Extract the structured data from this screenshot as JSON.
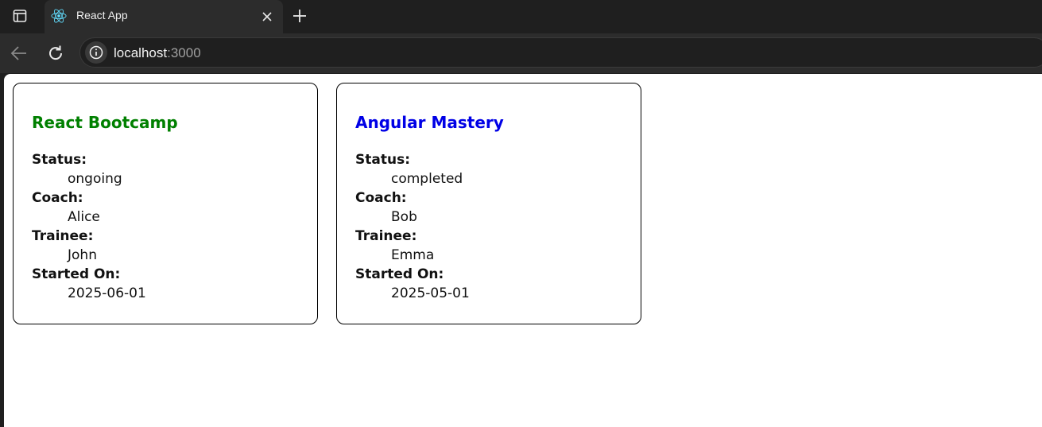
{
  "browser": {
    "tab_title": "React App",
    "url_host": "localhost",
    "url_port": ":3000"
  },
  "cards": [
    {
      "title": "React Bootcamp",
      "title_color": "#008000",
      "status_label": "Status:",
      "status": "ongoing",
      "coach_label": "Coach:",
      "coach": "Alice",
      "trainee_label": "Trainee:",
      "trainee": "John",
      "started_label": "Started On:",
      "started_on": "2025-06-01"
    },
    {
      "title": "Angular Mastery",
      "title_color": "#0000e6",
      "status_label": "Status:",
      "status": "completed",
      "coach_label": "Coach:",
      "coach": "Bob",
      "trainee_label": "Trainee:",
      "trainee": "Emma",
      "started_label": "Started On:",
      "started_on": "2025-05-01"
    }
  ],
  "icons": {
    "sidebar": "sidebar-toggle-icon",
    "favicon": "react-logo-icon",
    "close": "close-icon",
    "new_tab": "plus-icon",
    "back": "arrow-left-icon",
    "reload": "reload-icon",
    "site_info": "info-icon"
  }
}
